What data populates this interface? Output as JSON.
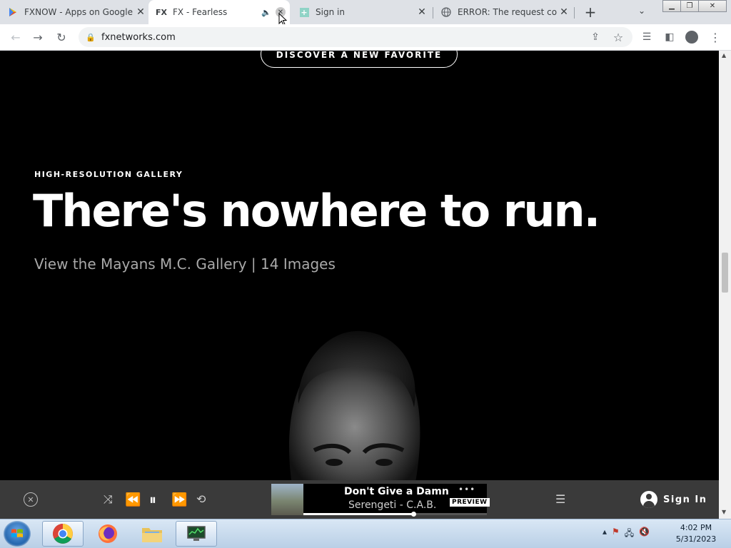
{
  "browser": {
    "tabs": [
      {
        "title": "FXNOW - Apps on Google Play",
        "favicon": "google-play-icon",
        "active": false
      },
      {
        "title": "FX - Fearless",
        "favicon": "fx-logo-icon",
        "favicon_text": "FX",
        "active": true,
        "audio": true
      },
      {
        "title": "Sign in",
        "favicon": "plus-page-icon",
        "active": false
      },
      {
        "title": "ERROR: The request could not be satisfied",
        "favicon": "globe-icon",
        "active": false
      }
    ],
    "url": "fxnetworks.com"
  },
  "page": {
    "cta": "DISCOVER A NEW FAVORITE",
    "eyebrow": "HIGH-RESOLUTION GALLERY",
    "headline": "There's nowhere to run.",
    "subline": "View the Mayans M.C. Gallery | 14 Images"
  },
  "player": {
    "song": "Don't Give a Damn",
    "artist": "Serengeti - C.A.B.",
    "badge": "PREVIEW",
    "more": "•••",
    "progress": 0.6,
    "signin": "Sign In"
  },
  "taskbar": {
    "time": "4:02 PM",
    "date": "5/31/2023"
  }
}
